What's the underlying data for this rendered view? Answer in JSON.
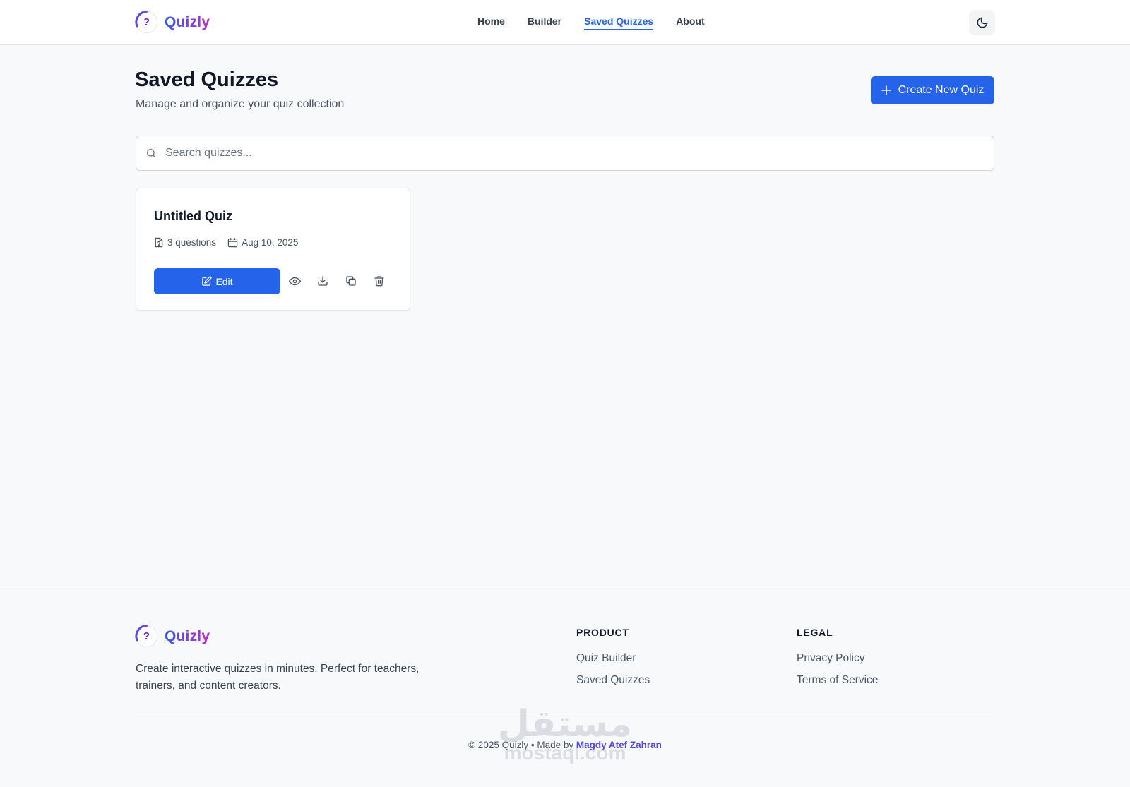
{
  "app": {
    "name": "Quizly",
    "logo_glyph": "?"
  },
  "nav": {
    "items": [
      {
        "label": "Home",
        "active": false
      },
      {
        "label": "Builder",
        "active": false
      },
      {
        "label": "Saved Quizzes",
        "active": true
      },
      {
        "label": "About",
        "active": false
      }
    ],
    "theme_toggle_icon": "moon-icon"
  },
  "page": {
    "title": "Saved Quizzes",
    "subtitle": "Manage and organize your quiz collection",
    "create_button": {
      "icon": "plus-icon",
      "label": "Create New Quiz"
    }
  },
  "search": {
    "placeholder": "Search quizzes...",
    "value": ""
  },
  "quizzes": [
    {
      "title": "Untitled Quiz",
      "questions": "3 questions",
      "date": "Aug 10, 2025",
      "edit_label": "Edit",
      "actions": [
        "eye-icon",
        "download-icon",
        "copy-icon",
        "trash-icon"
      ]
    }
  ],
  "footer": {
    "brand": "Quizly",
    "description": "Create interactive quizzes in minutes. Perfect for teachers, trainers, and content creators.",
    "product": {
      "heading": "PRODUCT",
      "links": [
        "Quiz Builder",
        "Saved Quizzes"
      ]
    },
    "legal": {
      "heading": "LEGAL",
      "links": [
        "Privacy Policy",
        "Terms of Service"
      ]
    },
    "copyright_prefix": "© 2025 Quizly • Made by ",
    "author": "Magdy Atef Zahran"
  },
  "watermark": {
    "arabic": "مستقل",
    "latin": "mostaql.com"
  },
  "colors": {
    "primary": "#2563eb",
    "brand_start": "#2f5de8",
    "brand_end": "#c026d3",
    "background": "#f8f9fb"
  }
}
